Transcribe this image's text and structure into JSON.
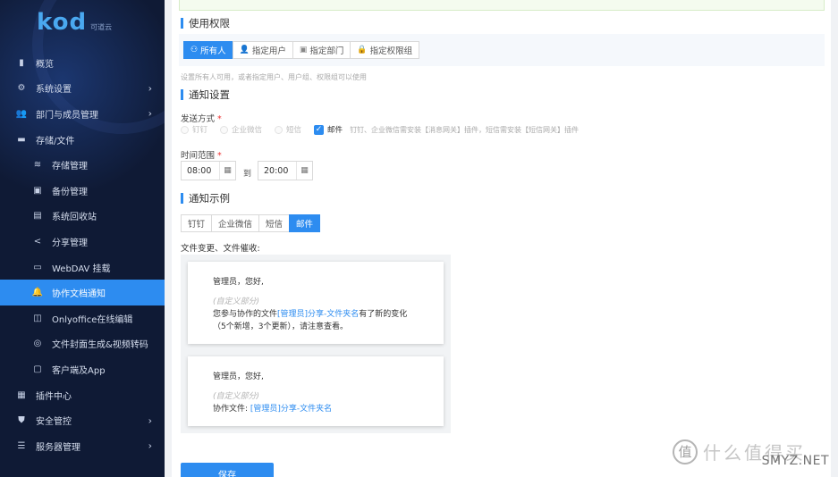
{
  "brand": {
    "logo": "kod",
    "sub": "可道云"
  },
  "sidebar": {
    "items": [
      {
        "label": "概览",
        "icon": "bar-chart-icon",
        "level": "top"
      },
      {
        "label": "系统设置",
        "icon": "gear-icon",
        "level": "top",
        "arrow": "›"
      },
      {
        "label": "部门与成员管理",
        "icon": "users-icon",
        "level": "top",
        "arrow": "›"
      },
      {
        "label": "存储/文件",
        "icon": "folder-icon",
        "level": "top",
        "expanded": true
      },
      {
        "label": "存储管理",
        "icon": "database-icon",
        "level": "sub"
      },
      {
        "label": "备份管理",
        "icon": "save-icon",
        "level": "sub"
      },
      {
        "label": "系统回收站",
        "icon": "trash-icon",
        "level": "sub"
      },
      {
        "label": "分享管理",
        "icon": "share-icon",
        "level": "sub"
      },
      {
        "label": "WebDAV 挂载",
        "icon": "drive-icon",
        "level": "sub"
      },
      {
        "label": "协作文档通知",
        "icon": "bell-icon",
        "level": "sub",
        "active": true
      },
      {
        "label": "Onlyoffice在线编辑",
        "icon": "office-icon",
        "level": "sub"
      },
      {
        "label": "文件封面生成&视频转码",
        "icon": "film-icon",
        "level": "sub"
      },
      {
        "label": "客户端及App",
        "icon": "monitor-icon",
        "level": "sub"
      },
      {
        "label": "插件中心",
        "icon": "grid-icon",
        "level": "top"
      },
      {
        "label": "安全管控",
        "icon": "shield-icon",
        "level": "top",
        "arrow": "›"
      },
      {
        "label": "服务器管理",
        "icon": "server-icon",
        "level": "top",
        "arrow": "›"
      }
    ]
  },
  "permissions": {
    "title": "使用权限",
    "tabs": [
      {
        "label": "所有人",
        "icon": "users-icon",
        "active": true
      },
      {
        "label": "指定用户",
        "icon": "user-add-icon",
        "active": false
      },
      {
        "label": "指定部门",
        "icon": "department-icon",
        "active": false
      },
      {
        "label": "指定权限组",
        "icon": "lock-icon",
        "active": false
      }
    ],
    "hint": "设置所有人可用，或者指定用户、用户组、权限组可以使用"
  },
  "notify": {
    "title": "通知设置",
    "method_label": "发送方式",
    "methods": [
      {
        "label": "钉钉",
        "type": "radio",
        "checked": false
      },
      {
        "label": "企业微信",
        "type": "radio",
        "checked": false
      },
      {
        "label": "短信",
        "type": "radio",
        "checked": false
      },
      {
        "label": "邮件",
        "type": "checkbox",
        "checked": true
      }
    ],
    "method_note": "钉钉、企业微信需安装【消息网关】插件，短信需安装【短信网关】插件",
    "time_label": "时间范围",
    "time_from": "08:00",
    "time_to_label": "到",
    "time_to": "20:00"
  },
  "example": {
    "title": "通知示例",
    "tabs": [
      {
        "label": "钉钉",
        "active": false
      },
      {
        "label": "企业微信",
        "active": false
      },
      {
        "label": "短信",
        "active": false
      },
      {
        "label": "邮件",
        "active": true
      }
    ],
    "label": "文件变更、文件催收:",
    "card1": {
      "greeting": "管理员，您好,",
      "custom": "(自定义部分)",
      "line_prefix": "您参与协作的文件",
      "link": "[管理员]分享-文件夹名",
      "line_suffix": "有了新的变化",
      "line2": "（5个新增，3个更新），请注意查看。"
    },
    "card2": {
      "greeting": "管理员，您好,",
      "custom": "(自定义部分)",
      "line_prefix": "协作文件: ",
      "link": "[管理员]分享-文件夹名"
    }
  },
  "save_label": "保存",
  "watermark": {
    "badge": "值",
    "text": "什么值得买",
    "site": "SMYZ.NET"
  },
  "colors": {
    "accent": "#2d8cf0",
    "sidebar_bg": "#0f1a35"
  }
}
